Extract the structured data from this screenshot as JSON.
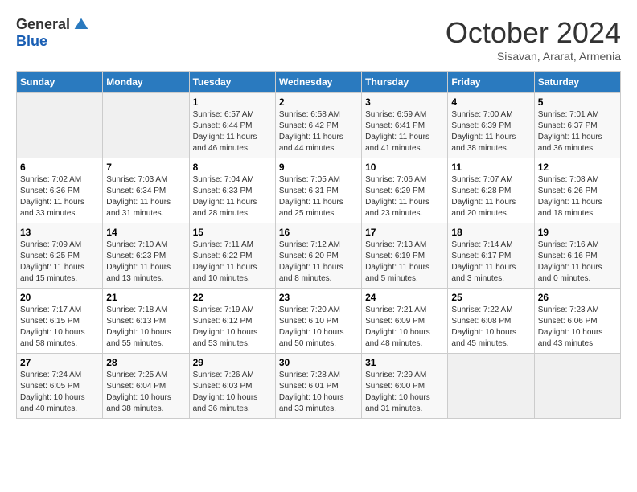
{
  "logo": {
    "general": "General",
    "blue": "Blue"
  },
  "title": "October 2024",
  "subtitle": "Sisavan, Ararat, Armenia",
  "days_header": [
    "Sunday",
    "Monday",
    "Tuesday",
    "Wednesday",
    "Thursday",
    "Friday",
    "Saturday"
  ],
  "weeks": [
    [
      {
        "day": "",
        "sunrise": "",
        "sunset": "",
        "daylight": ""
      },
      {
        "day": "",
        "sunrise": "",
        "sunset": "",
        "daylight": ""
      },
      {
        "day": "1",
        "sunrise": "Sunrise: 6:57 AM",
        "sunset": "Sunset: 6:44 PM",
        "daylight": "Daylight: 11 hours and 46 minutes."
      },
      {
        "day": "2",
        "sunrise": "Sunrise: 6:58 AM",
        "sunset": "Sunset: 6:42 PM",
        "daylight": "Daylight: 11 hours and 44 minutes."
      },
      {
        "day": "3",
        "sunrise": "Sunrise: 6:59 AM",
        "sunset": "Sunset: 6:41 PM",
        "daylight": "Daylight: 11 hours and 41 minutes."
      },
      {
        "day": "4",
        "sunrise": "Sunrise: 7:00 AM",
        "sunset": "Sunset: 6:39 PM",
        "daylight": "Daylight: 11 hours and 38 minutes."
      },
      {
        "day": "5",
        "sunrise": "Sunrise: 7:01 AM",
        "sunset": "Sunset: 6:37 PM",
        "daylight": "Daylight: 11 hours and 36 minutes."
      }
    ],
    [
      {
        "day": "6",
        "sunrise": "Sunrise: 7:02 AM",
        "sunset": "Sunset: 6:36 PM",
        "daylight": "Daylight: 11 hours and 33 minutes."
      },
      {
        "day": "7",
        "sunrise": "Sunrise: 7:03 AM",
        "sunset": "Sunset: 6:34 PM",
        "daylight": "Daylight: 11 hours and 31 minutes."
      },
      {
        "day": "8",
        "sunrise": "Sunrise: 7:04 AM",
        "sunset": "Sunset: 6:33 PM",
        "daylight": "Daylight: 11 hours and 28 minutes."
      },
      {
        "day": "9",
        "sunrise": "Sunrise: 7:05 AM",
        "sunset": "Sunset: 6:31 PM",
        "daylight": "Daylight: 11 hours and 25 minutes."
      },
      {
        "day": "10",
        "sunrise": "Sunrise: 7:06 AM",
        "sunset": "Sunset: 6:29 PM",
        "daylight": "Daylight: 11 hours and 23 minutes."
      },
      {
        "day": "11",
        "sunrise": "Sunrise: 7:07 AM",
        "sunset": "Sunset: 6:28 PM",
        "daylight": "Daylight: 11 hours and 20 minutes."
      },
      {
        "day": "12",
        "sunrise": "Sunrise: 7:08 AM",
        "sunset": "Sunset: 6:26 PM",
        "daylight": "Daylight: 11 hours and 18 minutes."
      }
    ],
    [
      {
        "day": "13",
        "sunrise": "Sunrise: 7:09 AM",
        "sunset": "Sunset: 6:25 PM",
        "daylight": "Daylight: 11 hours and 15 minutes."
      },
      {
        "day": "14",
        "sunrise": "Sunrise: 7:10 AM",
        "sunset": "Sunset: 6:23 PM",
        "daylight": "Daylight: 11 hours and 13 minutes."
      },
      {
        "day": "15",
        "sunrise": "Sunrise: 7:11 AM",
        "sunset": "Sunset: 6:22 PM",
        "daylight": "Daylight: 11 hours and 10 minutes."
      },
      {
        "day": "16",
        "sunrise": "Sunrise: 7:12 AM",
        "sunset": "Sunset: 6:20 PM",
        "daylight": "Daylight: 11 hours and 8 minutes."
      },
      {
        "day": "17",
        "sunrise": "Sunrise: 7:13 AM",
        "sunset": "Sunset: 6:19 PM",
        "daylight": "Daylight: 11 hours and 5 minutes."
      },
      {
        "day": "18",
        "sunrise": "Sunrise: 7:14 AM",
        "sunset": "Sunset: 6:17 PM",
        "daylight": "Daylight: 11 hours and 3 minutes."
      },
      {
        "day": "19",
        "sunrise": "Sunrise: 7:16 AM",
        "sunset": "Sunset: 6:16 PM",
        "daylight": "Daylight: 11 hours and 0 minutes."
      }
    ],
    [
      {
        "day": "20",
        "sunrise": "Sunrise: 7:17 AM",
        "sunset": "Sunset: 6:15 PM",
        "daylight": "Daylight: 10 hours and 58 minutes."
      },
      {
        "day": "21",
        "sunrise": "Sunrise: 7:18 AM",
        "sunset": "Sunset: 6:13 PM",
        "daylight": "Daylight: 10 hours and 55 minutes."
      },
      {
        "day": "22",
        "sunrise": "Sunrise: 7:19 AM",
        "sunset": "Sunset: 6:12 PM",
        "daylight": "Daylight: 10 hours and 53 minutes."
      },
      {
        "day": "23",
        "sunrise": "Sunrise: 7:20 AM",
        "sunset": "Sunset: 6:10 PM",
        "daylight": "Daylight: 10 hours and 50 minutes."
      },
      {
        "day": "24",
        "sunrise": "Sunrise: 7:21 AM",
        "sunset": "Sunset: 6:09 PM",
        "daylight": "Daylight: 10 hours and 48 minutes."
      },
      {
        "day": "25",
        "sunrise": "Sunrise: 7:22 AM",
        "sunset": "Sunset: 6:08 PM",
        "daylight": "Daylight: 10 hours and 45 minutes."
      },
      {
        "day": "26",
        "sunrise": "Sunrise: 7:23 AM",
        "sunset": "Sunset: 6:06 PM",
        "daylight": "Daylight: 10 hours and 43 minutes."
      }
    ],
    [
      {
        "day": "27",
        "sunrise": "Sunrise: 7:24 AM",
        "sunset": "Sunset: 6:05 PM",
        "daylight": "Daylight: 10 hours and 40 minutes."
      },
      {
        "day": "28",
        "sunrise": "Sunrise: 7:25 AM",
        "sunset": "Sunset: 6:04 PM",
        "daylight": "Daylight: 10 hours and 38 minutes."
      },
      {
        "day": "29",
        "sunrise": "Sunrise: 7:26 AM",
        "sunset": "Sunset: 6:03 PM",
        "daylight": "Daylight: 10 hours and 36 minutes."
      },
      {
        "day": "30",
        "sunrise": "Sunrise: 7:28 AM",
        "sunset": "Sunset: 6:01 PM",
        "daylight": "Daylight: 10 hours and 33 minutes."
      },
      {
        "day": "31",
        "sunrise": "Sunrise: 7:29 AM",
        "sunset": "Sunset: 6:00 PM",
        "daylight": "Daylight: 10 hours and 31 minutes."
      },
      {
        "day": "",
        "sunrise": "",
        "sunset": "",
        "daylight": ""
      },
      {
        "day": "",
        "sunrise": "",
        "sunset": "",
        "daylight": ""
      }
    ]
  ]
}
